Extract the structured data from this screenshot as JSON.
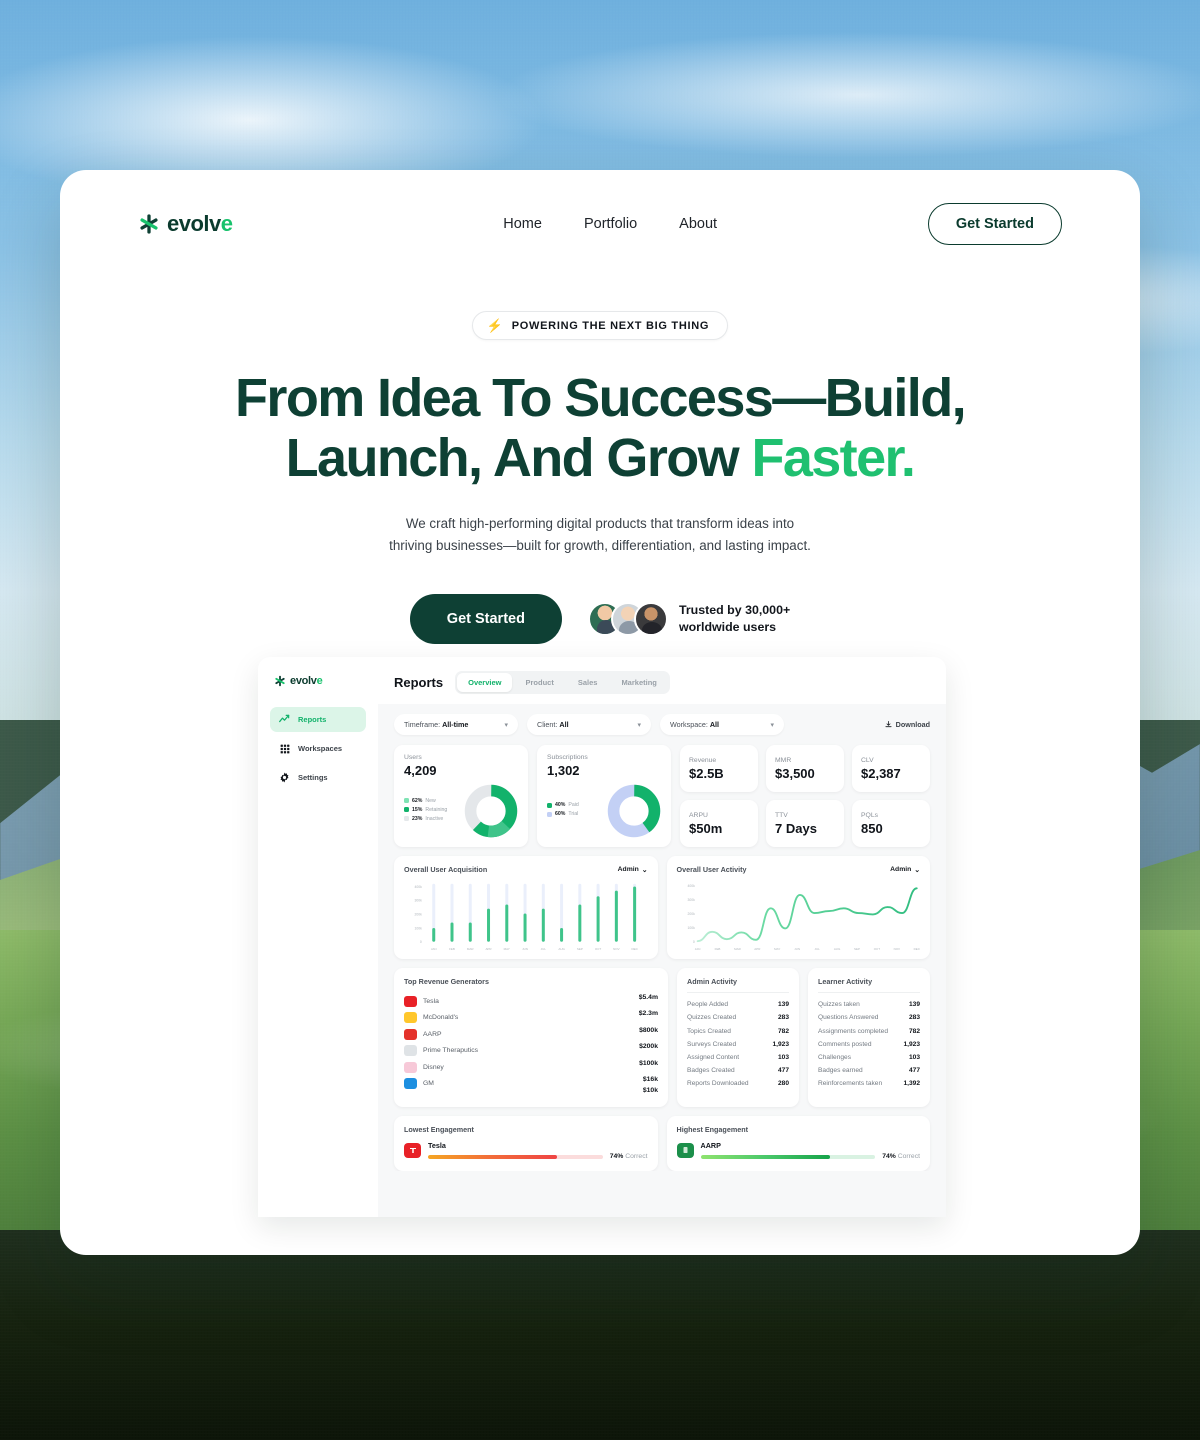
{
  "brand": {
    "name_dark": "evolv",
    "name_accent": "e",
    "accent": "#18c26c",
    "dark": "#0e4034"
  },
  "nav": {
    "links": [
      "Home",
      "Portfolio",
      "About"
    ],
    "cta": "Get Started"
  },
  "hero": {
    "badge": "POWERING THE NEXT BIG THING",
    "title_line1": "From Idea To Success—Build,",
    "title_line2_pre": "Launch, And Grow ",
    "title_line2_accent": "Faster.",
    "subtitle": "We craft high-performing digital products that transform ideas into thriving businesses—built for growth, differentiation, and lasting impact.",
    "cta": "Get Started",
    "trust_line1": "Trusted by 30,000+",
    "trust_line2": "worldwide users"
  },
  "dashboard": {
    "logo_dark": "evolv",
    "logo_accent": "e",
    "sidebar": [
      {
        "label": "Reports",
        "icon": "trend-up-icon",
        "active": true
      },
      {
        "label": "Workspaces",
        "icon": "grid-icon",
        "active": false
      },
      {
        "label": "Settings",
        "icon": "gear-icon",
        "active": false
      }
    ],
    "title": "Reports",
    "tabs": [
      {
        "label": "Overview",
        "active": true
      },
      {
        "label": "Product",
        "active": false
      },
      {
        "label": "Sales",
        "active": false
      },
      {
        "label": "Marketing",
        "active": false
      }
    ],
    "filters": [
      {
        "label": "Timeframe:",
        "value": "All-time"
      },
      {
        "label": "Client:",
        "value": "All"
      },
      {
        "label": "Workspace:",
        "value": "All"
      }
    ],
    "download": "Download",
    "kpi_users": {
      "label": "Users",
      "value": "4,209",
      "legend": [
        {
          "pct": "62%",
          "name": "New",
          "color": "#7fe3b4"
        },
        {
          "pct": "15%",
          "name": "Retaining",
          "color": "#12b26b"
        },
        {
          "pct": "23%",
          "name": "Inactive",
          "color": "#e4e7ea"
        }
      ]
    },
    "kpi_subs": {
      "label": "Subscriptions",
      "value": "1,302",
      "legend": [
        {
          "pct": "40%",
          "name": "Paid",
          "color": "#12b26b"
        },
        {
          "pct": "60%",
          "name": "Trial",
          "color": "#c3d0f5"
        }
      ]
    },
    "kpi_small": [
      {
        "label": "Revenue",
        "value": "$2.5B"
      },
      {
        "label": "MMR",
        "value": "$3,500"
      },
      {
        "label": "CLV",
        "value": "$2,387"
      },
      {
        "label": "ARPU",
        "value": "$50m"
      },
      {
        "label": "TTV",
        "value": "7 Days"
      },
      {
        "label": "PQLs",
        "value": "850"
      }
    ],
    "revenue_title": "Top Revenue Generators",
    "revenue_rows": [
      {
        "name": "Tesla",
        "value": "$5.4m",
        "color": "#e82127"
      },
      {
        "name": "McDonald's",
        "value": "$2.3m",
        "color": "#ffc72c"
      },
      {
        "name": "AARP",
        "value": "$800k",
        "color": "#e4322b"
      },
      {
        "name": "Prime Theraputics",
        "value": "$200k",
        "color": "#dfe3e6"
      },
      {
        "name": "Disney",
        "value": "$100k",
        "color": "#f7c9d8"
      },
      {
        "name": "GM",
        "value": "$16k",
        "color": "#1d8fe0"
      }
    ],
    "revenue_extra": "$10k",
    "admin_activity": {
      "title": "Admin Activity",
      "rows": [
        {
          "label": "People Added",
          "value": "139"
        },
        {
          "label": "Quizzes Created",
          "value": "283"
        },
        {
          "label": "Topics Created",
          "value": "782"
        },
        {
          "label": "Surveys Created",
          "value": "1,923"
        },
        {
          "label": "Assigned Content",
          "value": "103"
        },
        {
          "label": "Badges Created",
          "value": "477"
        },
        {
          "label": "Reports Downloaded",
          "value": "280"
        }
      ]
    },
    "learner_activity": {
      "title": "Learner Activity",
      "rows": [
        {
          "label": "Quizzes taken",
          "value": "139"
        },
        {
          "label": "Questions Answered",
          "value": "283"
        },
        {
          "label": "Assignments completed",
          "value": "782"
        },
        {
          "label": "Comments posted",
          "value": "1,923"
        },
        {
          "label": "Challenges",
          "value": "103"
        },
        {
          "label": "Badges earned",
          "value": "477"
        },
        {
          "label": "Reinforcements taken",
          "value": "1,392"
        }
      ]
    },
    "lowest_engagement": {
      "title": "Lowest Engagement",
      "name": "Tesla",
      "pct": "74%",
      "pct_suffix": "Correct",
      "fill": 74
    },
    "highest_engagement": {
      "title": "Highest Engagement",
      "name": "AARP",
      "pct": "74%",
      "pct_suffix": "Correct",
      "fill": 74
    }
  },
  "chart_data": [
    {
      "type": "bar",
      "title": "Overall User Acquisition",
      "selector": "Admin",
      "categories": [
        "JAN",
        "FEB",
        "MAR",
        "APR",
        "MAY",
        "JUN",
        "JUL",
        "AUG",
        "SEP",
        "OCT",
        "NOV",
        "DEC"
      ],
      "values": [
        100000,
        140000,
        140000,
        240000,
        270000,
        205000,
        240000,
        100000,
        270000,
        330000,
        370000,
        400000
      ],
      "ytick_labels": [
        "0",
        "100k",
        "200k",
        "300k",
        "400k"
      ],
      "ylim": [
        0,
        420000
      ],
      "xlabel": "",
      "ylabel": "",
      "grid": false,
      "legend": "none",
      "series_color": "#3fc48a",
      "track_color": "#eaeffb"
    },
    {
      "type": "line",
      "title": "Overall User Activity",
      "selector": "Admin",
      "categories": [
        "JAN",
        "FEB",
        "MAR",
        "APR",
        "MAY",
        "JUN",
        "JUL",
        "AUG",
        "SEP",
        "OCT",
        "NOV",
        "DEC"
      ],
      "x": [
        0,
        1,
        2,
        3,
        4,
        5,
        6,
        7,
        8,
        9,
        10,
        11
      ],
      "values": [
        5000,
        75000,
        20000,
        70000,
        15000,
        250000,
        100000,
        350000,
        215000,
        230000,
        250000,
        215000,
        205000,
        260000,
        215000,
        400000
      ],
      "ytick_labels": [
        "0",
        "100k",
        "200k",
        "300k",
        "400k"
      ],
      "ylim": [
        0,
        420000
      ],
      "xlabel": "",
      "ylabel": "",
      "grid": false,
      "legend": "none",
      "series_color": "#3fc48a"
    }
  ]
}
